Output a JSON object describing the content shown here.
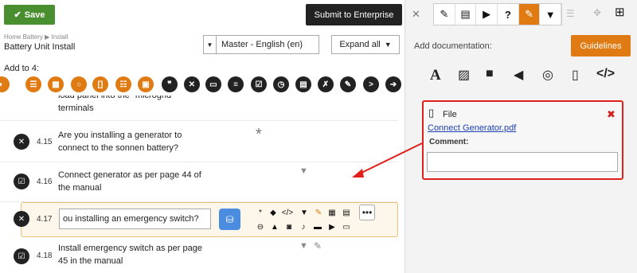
{
  "header": {
    "save_label": "Save",
    "submit_label": "Submit to Enterprise"
  },
  "breadcrumb": {
    "home": "Home Battery",
    "sep": "▶",
    "current": "Install"
  },
  "page_title": "Battery Unit Install",
  "language": {
    "selected": "Master - English (en)"
  },
  "expand_label": "Expand all",
  "add_to_label": "Add to 4:",
  "rows": [
    {
      "num": "",
      "text1": "load panel into the \"microgrid\"",
      "text2": "terminals"
    },
    {
      "num": "4.15",
      "text1": "Are you installing a generator to",
      "text2": "connect to the sonnen battery?"
    },
    {
      "num": "4.16",
      "text1": "Connect generator as per page 44 of",
      "text2": "the manual"
    },
    {
      "num": "4.17",
      "input_value": "ou installing an emergency switch?"
    },
    {
      "num": "4.18",
      "text1": "Install emergency switch as per page",
      "text2": "45 in the manual"
    }
  ],
  "right": {
    "add_doc_label": "Add documentation:",
    "guidelines_label": "Guidelines",
    "file": {
      "type_label": "File",
      "link_text": "Connect Generator.pdf",
      "comment_label": "Comment:",
      "comment_value": ""
    }
  },
  "colors": {
    "accent": "#e07b13",
    "save_green": "#4a8f2f",
    "highlight_red": "#e0201c",
    "link_blue": "#1a3fb0"
  }
}
